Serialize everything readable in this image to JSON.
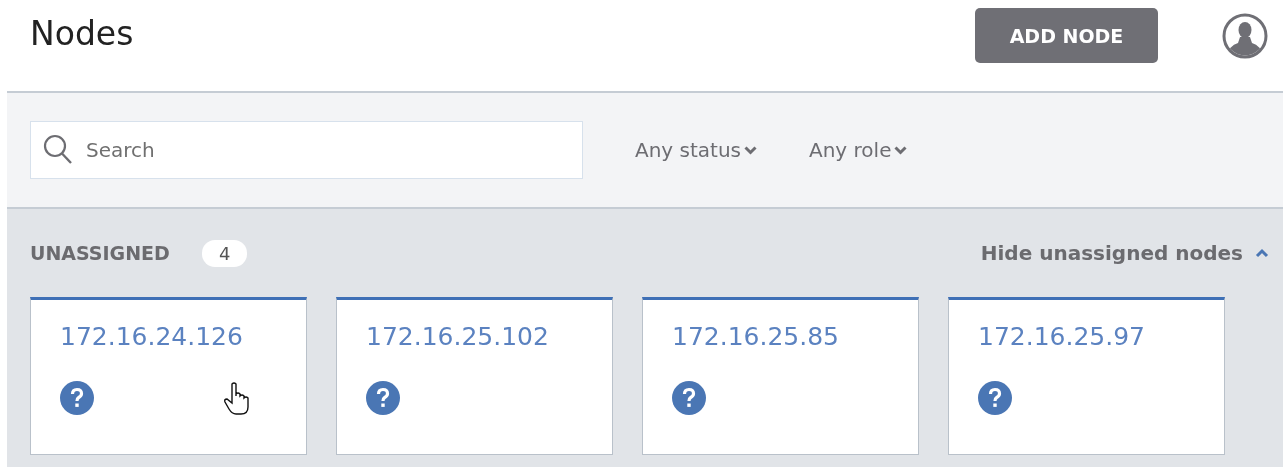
{
  "header": {
    "title": "Nodes",
    "add_button": "ADD NODE"
  },
  "filters": {
    "search": {
      "placeholder": "Search"
    },
    "dropdowns": [
      "Any status",
      "Any role"
    ]
  },
  "section": {
    "title": "UNASSIGNED",
    "count": "4",
    "toggle": "Hide unassigned nodes",
    "expanded": true,
    "nodes": [
      {
        "address": "172.16.24.126",
        "hovered": true
      },
      {
        "address": "172.16.25.102",
        "hovered": false
      },
      {
        "address": "172.16.25.85",
        "hovered": false
      },
      {
        "address": "172.16.25.97",
        "hovered": false
      }
    ]
  }
}
